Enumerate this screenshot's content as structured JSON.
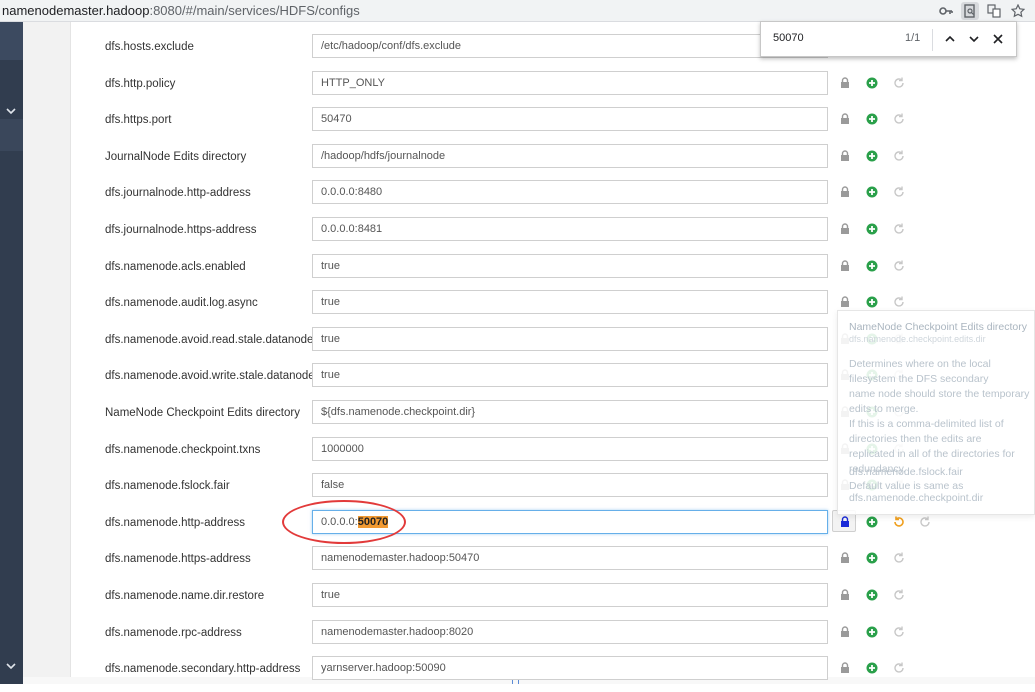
{
  "browser": {
    "url_host": "namenodemaster.hadoop",
    "url_rest": ":8080/#/main/services/HDFS/configs"
  },
  "find": {
    "query": "50070",
    "count": "1/1"
  },
  "rows": [
    {
      "label": "dfs.hosts.exclude",
      "value": "/etc/hadoop/conf/dfs.exclude"
    },
    {
      "label": "dfs.http.policy",
      "value": "HTTP_ONLY"
    },
    {
      "label": "dfs.https.port",
      "value": "50470"
    },
    {
      "label": "JournalNode Edits directory",
      "value": "/hadoop/hdfs/journalnode"
    },
    {
      "label": "dfs.journalnode.http-address",
      "value": "0.0.0.0:8480"
    },
    {
      "label": "dfs.journalnode.https-address",
      "value": "0.0.0.0:8481"
    },
    {
      "label": "dfs.namenode.acls.enabled",
      "value": "true"
    },
    {
      "label": "dfs.namenode.audit.log.async",
      "value": "true"
    },
    {
      "label": "dfs.namenode.avoid.read.stale.datanode",
      "value": "true"
    },
    {
      "label": "dfs.namenode.avoid.write.stale.datanode",
      "value": "true"
    },
    {
      "label": "NameNode Checkpoint Edits directory",
      "value": "${dfs.namenode.checkpoint.dir}"
    },
    {
      "label": "dfs.namenode.checkpoint.txns",
      "value": "1000000"
    },
    {
      "label": "dfs.namenode.fslock.fair",
      "value": "false"
    },
    {
      "label": "dfs.namenode.http-address",
      "value_prefix": "0.0.0.0:",
      "value_match": "50070"
    },
    {
      "label": "dfs.namenode.https-address",
      "value": "namenodemaster.hadoop:50470"
    },
    {
      "label": "dfs.namenode.name.dir.restore",
      "value": "true"
    },
    {
      "label": "dfs.namenode.rpc-address",
      "value": "namenodemaster.hadoop:8020"
    },
    {
      "label": "dfs.namenode.secondary.http-address",
      "value": "yarnserver.hadoop:50090"
    }
  ],
  "tooltip": {
    "title": "NameNode Checkpoint Edits directory",
    "key": "dfs.namenode.checkpoint.edits.dir",
    "line1": "Determines where on the local",
    "line2": "filesystem the DFS secondary",
    "line3": "name node should store the temporary",
    "line4": "edits to merge.",
    "line5": "If this is a comma-delimited list of",
    "line6": "directories then the edits are",
    "line7": "replicated in all of the directories for",
    "line8": "redundancy.",
    "line9": "dfs.namenode.fslock.fair",
    "line10": "Default value is same as",
    "line11": "dfs.namenode.checkpoint.dir"
  },
  "colors": {
    "accent_green": "#2aa04a",
    "undo_orange": "#f0a020",
    "lock_blue": "#1a2ad8",
    "highlight": "#f29a32",
    "annotation_red": "#e23a3a"
  }
}
